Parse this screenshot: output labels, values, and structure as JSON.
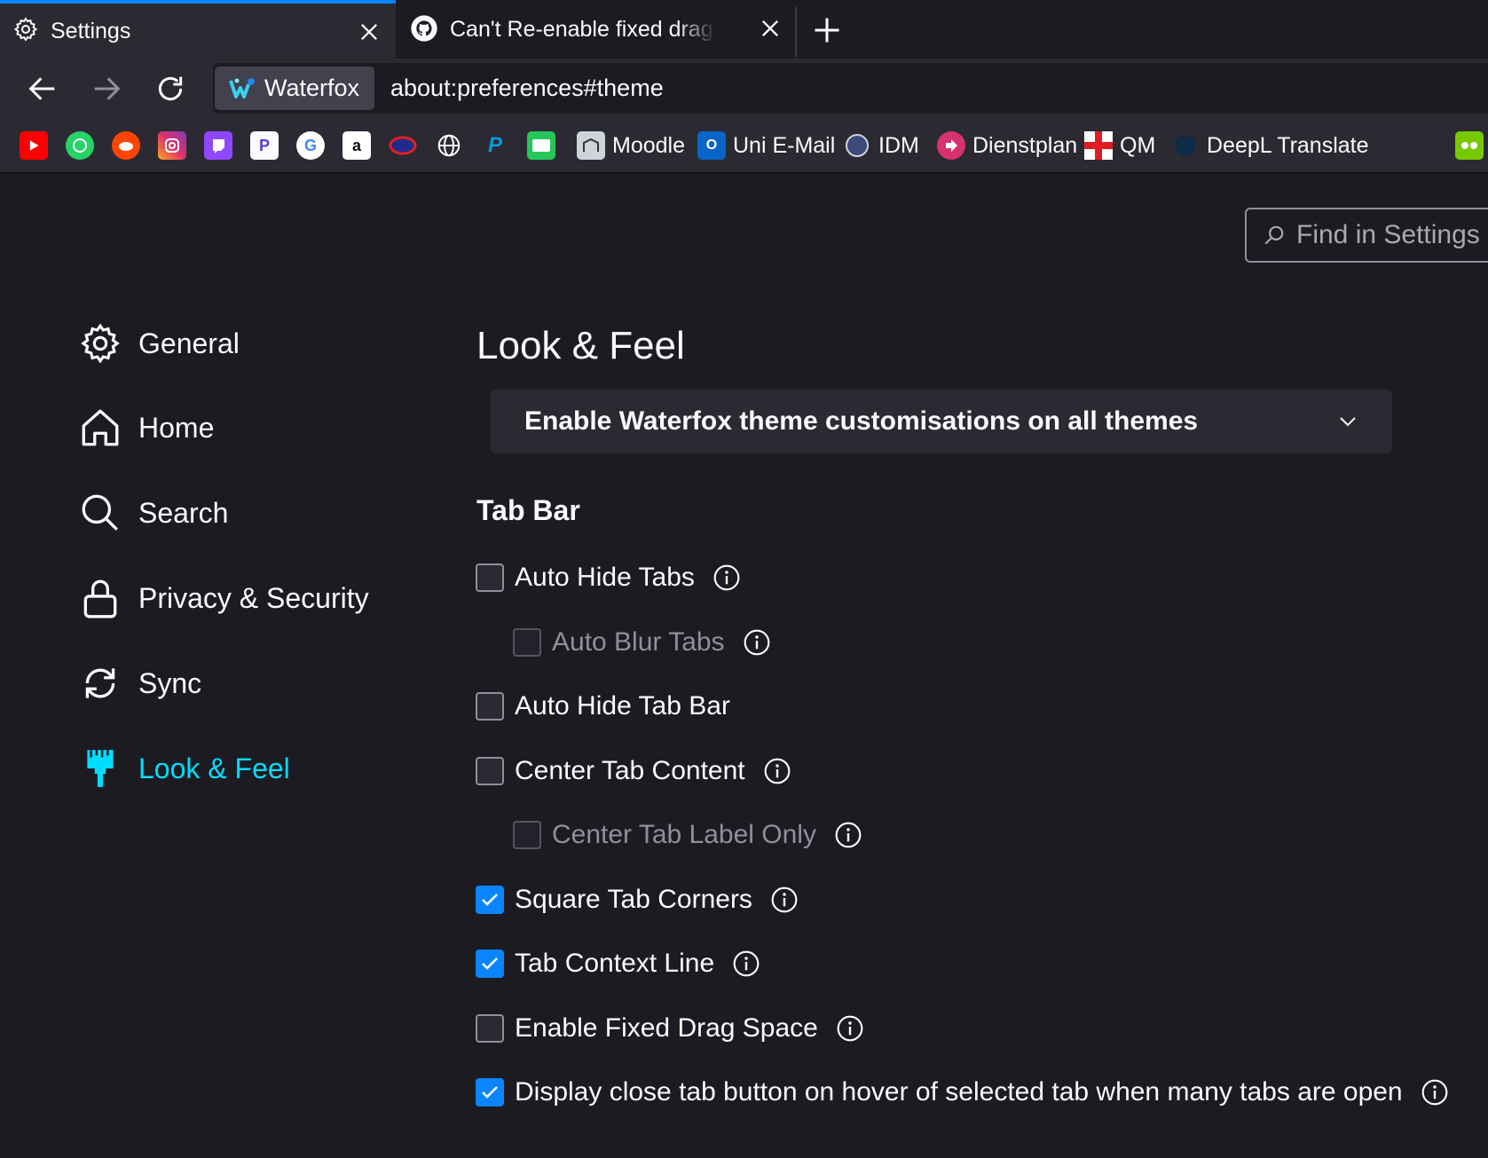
{
  "tabs": [
    {
      "title": "Settings",
      "icon": "gear-icon",
      "active": true
    },
    {
      "title": "Can't Re-enable fixed drag space",
      "icon": "github-icon",
      "active": false
    }
  ],
  "navbar": {
    "identity_label": "Waterfox",
    "url": "about:preferences#theme"
  },
  "bookmarks": [
    {
      "icon": "youtube-icon",
      "label": ""
    },
    {
      "icon": "whatsapp-icon",
      "label": ""
    },
    {
      "icon": "reddit-icon",
      "label": ""
    },
    {
      "icon": "instagram-icon",
      "label": ""
    },
    {
      "icon": "twitch-icon",
      "label": ""
    },
    {
      "icon": "p-icon",
      "label": ""
    },
    {
      "icon": "google-icon",
      "label": ""
    },
    {
      "icon": "amazon-icon",
      "label": ""
    },
    {
      "icon": "red-circle-icon",
      "label": ""
    },
    {
      "icon": "globe-icon",
      "label": ""
    },
    {
      "icon": "paypal-icon",
      "label": ""
    },
    {
      "icon": "green-app-icon",
      "label": ""
    },
    {
      "icon": "moodle-icon",
      "label": "Moodle"
    },
    {
      "icon": "outlook-icon",
      "label": "Uni E-Mail"
    },
    {
      "icon": "idm-icon",
      "label": "IDM"
    },
    {
      "icon": "dienstplan-icon",
      "label": "Dienstplan"
    },
    {
      "icon": "qm-cross-icon",
      "label": "QM"
    },
    {
      "icon": "deepl-icon",
      "label": "DeepL Translate"
    },
    {
      "icon": "duolingo-icon",
      "label": ""
    }
  ],
  "search": {
    "placeholder": "Find in Settings"
  },
  "sidebar": {
    "items": [
      {
        "label": "General",
        "icon": "gear-icon"
      },
      {
        "label": "Home",
        "icon": "home-icon"
      },
      {
        "label": "Search",
        "icon": "search-icon"
      },
      {
        "label": "Privacy & Security",
        "icon": "lock-icon"
      },
      {
        "label": "Sync",
        "icon": "sync-icon"
      },
      {
        "label": "Look & Feel",
        "icon": "paintbrush-icon",
        "selected": true
      }
    ]
  },
  "main": {
    "title": "Look & Feel",
    "dropdown_value": "Enable Waterfox theme customisations on all themes",
    "section_heading": "Tab Bar",
    "options": [
      {
        "label": "Auto Hide Tabs",
        "checked": false,
        "disabled": false,
        "indent": false,
        "info": true
      },
      {
        "label": "Auto Blur Tabs",
        "checked": false,
        "disabled": true,
        "indent": true,
        "info": true
      },
      {
        "label": "Auto Hide Tab Bar",
        "checked": false,
        "disabled": false,
        "indent": false,
        "info": false
      },
      {
        "label": "Center Tab Content",
        "checked": false,
        "disabled": false,
        "indent": false,
        "info": true
      },
      {
        "label": "Center Tab Label Only",
        "checked": false,
        "disabled": true,
        "indent": true,
        "info": true
      },
      {
        "label": "Square Tab Corners",
        "checked": true,
        "disabled": false,
        "indent": false,
        "info": true
      },
      {
        "label": "Tab Context Line",
        "checked": true,
        "disabled": false,
        "indent": false,
        "info": true
      },
      {
        "label": "Enable Fixed Drag Space",
        "checked": false,
        "disabled": false,
        "indent": false,
        "info": true
      },
      {
        "label": "Display close tab button on hover of selected tab when many tabs are open",
        "checked": true,
        "disabled": false,
        "indent": false,
        "info": true
      }
    ]
  },
  "colors": {
    "accent": "#00ddff",
    "checkbox_checked": "#0a84ff",
    "background": "#1c1b22",
    "chrome": "#2b2a33"
  }
}
